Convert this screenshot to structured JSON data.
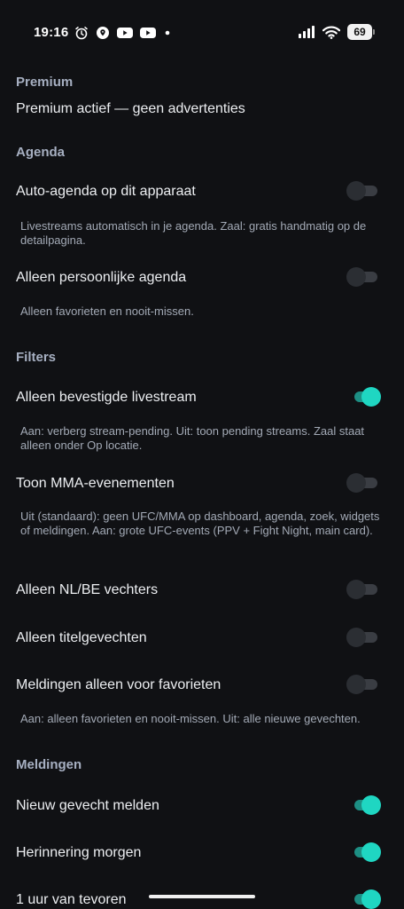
{
  "statusbar": {
    "time": "19:16",
    "battery": "69",
    "left_icons": [
      "alarm-icon",
      "location-pin-icon",
      "youtube-icon",
      "youtube-icon",
      "dot-icon"
    ],
    "right_icons": [
      "signal-icon",
      "wifi-icon",
      "battery-icon"
    ]
  },
  "colors": {
    "background": "#101114",
    "section_header": "#a7b0c2",
    "toggle_on_thumb": "#1fd6c2",
    "toggle_on_track": "#1d8f84",
    "toggle_off_thumb": "#2b2e33"
  },
  "premium": {
    "header": "Premium",
    "status": "Premium actief — geen advertenties"
  },
  "agenda": {
    "header": "Agenda",
    "auto_agenda": {
      "label": "Auto-agenda op dit apparaat",
      "on": false,
      "description": "Livestreams automatisch in je agenda. Zaal: gratis handmatig op de detailpagina."
    },
    "personal_agenda": {
      "label": "Alleen persoonlijke agenda",
      "on": false,
      "description": "Alleen favorieten en nooit-missen."
    }
  },
  "filters": {
    "header": "Filters",
    "confirmed_livestream": {
      "label": "Alleen bevestigde livestream",
      "on": true,
      "description": "Aan: verberg stream-pending. Uit: toon pending streams. Zaal staat alleen onder Op locatie."
    },
    "mma_events": {
      "label": "Toon MMA-evenementen",
      "on": false,
      "description": "Uit (standaard): geen UFC/MMA op dashboard, agenda, zoek, widgets of meldingen. Aan: grote UFC-events (PPV + Fight Night, main card)."
    },
    "nl_be_fighters": {
      "label": "Alleen NL/BE vechters",
      "on": false
    },
    "title_fights": {
      "label": "Alleen titelgevechten",
      "on": false
    },
    "favorites_notifications": {
      "label": "Meldingen alleen voor favorieten",
      "on": false,
      "description": "Aan: alleen favorieten en nooit-missen. Uit: alle nieuwe gevechten."
    }
  },
  "notifications": {
    "header": "Meldingen",
    "new_fight": {
      "label": "Nieuw gevecht melden",
      "on": true
    },
    "reminder_tomorrow": {
      "label": "Herinnering morgen",
      "on": true
    },
    "one_hour_before": {
      "label": "1 uur van tevoren",
      "on": true
    }
  }
}
